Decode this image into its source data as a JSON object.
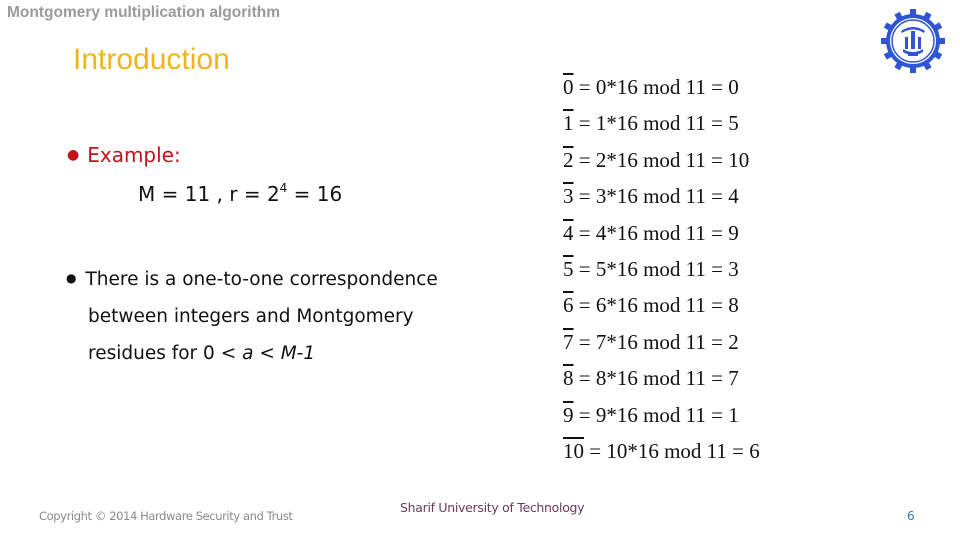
{
  "header": {
    "title": "Montgomery multiplication algorithm",
    "section": "Introduction"
  },
  "logo": {
    "icon": "university-gear-emblem-icon",
    "color": "#2f55d4"
  },
  "content": {
    "bullet1": {
      "label": "Example:",
      "equation_prefix": "M = 11 , r = 2",
      "equation_exponent": "4",
      "equation_suffix": " = 16"
    },
    "bullet2": {
      "line1": "There is a one-to-one correspondence",
      "line2": "between integers and Montgomery",
      "line3_prefix": "residues for 0 < ",
      "line3_var_a": "a",
      "line3_mid": " < ",
      "line3_var_m": "M-1"
    },
    "equations": [
      {
        "residue": "0",
        "expr": " = 0*16 mod 11 = 0"
      },
      {
        "residue": "1",
        "expr": " = 1*16 mod 11 = 5"
      },
      {
        "residue": "2",
        "expr": " = 2*16 mod 11 = 10"
      },
      {
        "residue": "3",
        "expr": " = 3*16 mod 11 = 4"
      },
      {
        "residue": "4",
        "expr": " = 4*16 mod 11 = 9"
      },
      {
        "residue": "5",
        "expr": " = 5*16 mod 11 = 3"
      },
      {
        "residue": "6",
        "expr": " = 6*16 mod 11 = 8"
      },
      {
        "residue": "7",
        "expr": " = 7*16 mod 11 = 2"
      },
      {
        "residue": "8",
        "expr": " = 8*16 mod 11 = 7"
      },
      {
        "residue": "9",
        "expr": " = 9*16 mod 11 = 1"
      },
      {
        "residue": "10",
        "expr": " = 10*16 mod 11 = 6"
      }
    ]
  },
  "footer": {
    "copyright": "Copyright © 2014 Hardware Security and Trust",
    "university": "Sharif University of Technology",
    "page_number": "6"
  },
  "colors": {
    "header_gray": "#9a9a9a",
    "section_gold": "#f0b41c",
    "bullet_red": "#c0141c",
    "university_purple": "#6b3a5e",
    "page_number_blue": "#2a7fa8"
  }
}
